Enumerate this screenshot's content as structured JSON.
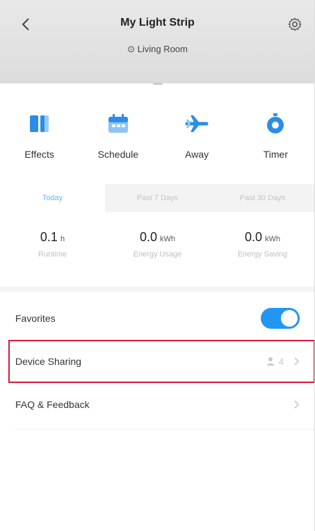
{
  "header": {
    "title": "My Light Strip",
    "room": "⊙ Living Room"
  },
  "controls": [
    {
      "label": "Effects",
      "icon": "effects-icon"
    },
    {
      "label": "Schedule",
      "icon": "calendar-icon"
    },
    {
      "label": "Away",
      "icon": "airplane-icon"
    },
    {
      "label": "Timer",
      "icon": "stopwatch-icon"
    }
  ],
  "tabs": [
    {
      "label": "Today",
      "active": true
    },
    {
      "label": "Past 7 Days",
      "active": false
    },
    {
      "label": "Past 30 Days",
      "active": false
    }
  ],
  "stats": [
    {
      "value": "0.1",
      "unit": "h",
      "caption": "Runtime"
    },
    {
      "value": "0.0",
      "unit": "kWh",
      "caption": "Energy Usage"
    },
    {
      "value": "0.0",
      "unit": "kWh",
      "caption": "Energy Saving"
    }
  ],
  "list": {
    "favorites": {
      "label": "Favorites",
      "toggle_on": true
    },
    "device_sharing": {
      "label": "Device Sharing",
      "count": "4"
    },
    "faq": {
      "label": "FAQ & Feedback"
    }
  },
  "colors": {
    "accent": "#2196f3",
    "tab_active_text": "#64b5f6",
    "icon_blue": "#2a8ee8",
    "highlight": "#d11a3b"
  }
}
